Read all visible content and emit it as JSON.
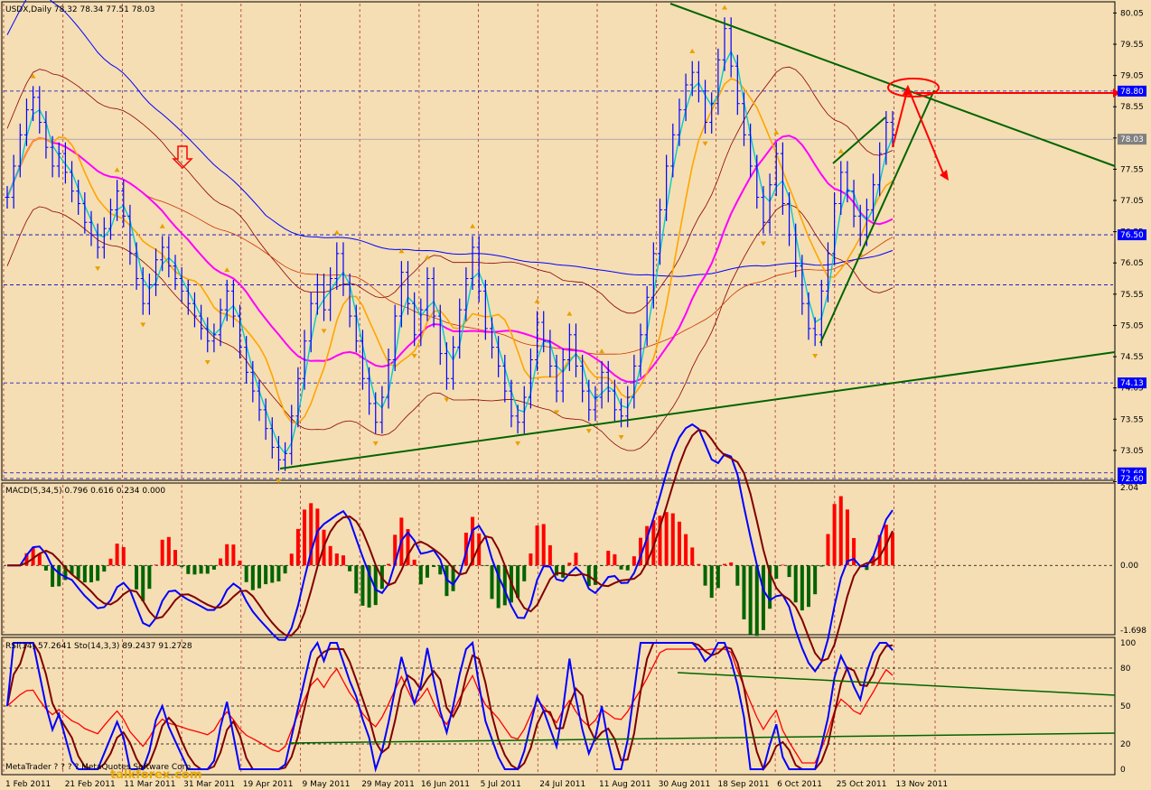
{
  "header": {
    "main": "USDX,Daily  78.32 78.34 77.51 78.03",
    "macd": "MACD(5,34,5) 0.796 0.616 0.234 0.000",
    "rsi": "RSI(14) 57.2641  Sto(14,3,3) 89.2437 91.2728"
  },
  "watermark": {
    "text": "MetaTrader ? ? ? ? MetaQuotes Software Corp.",
    "site": "talkforex.com"
  },
  "colors": {
    "background": "#f5deb3",
    "bull_bar": "#0000ff",
    "bear_bar": "#0000ff",
    "ma_fast": "#00cccc",
    "ma_mid": "#ffa500",
    "ma_slow": "#ff00ff",
    "ma_long": "#0000ff",
    "bands": "#8b0000",
    "trendline": "#006400",
    "marker": "#ff0000",
    "hist_up": "#ff0000",
    "hist_down": "#006400"
  },
  "icons": [
    "down-arrow-signal-icon",
    "fractal-up-icon",
    "fractal-down-icon",
    "target-ellipse-icon",
    "projection-arrow-icon"
  ],
  "chart_data": [
    {
      "type": "candlestick",
      "symbol": "USDX",
      "timeframe": "Daily",
      "ohlc_last": {
        "open": 78.32,
        "high": 78.34,
        "low": 77.51,
        "close": 78.03
      },
      "ylim": [
        72.6,
        80.2
      ],
      "y_ticks": [
        "80.05",
        "79.55",
        "79.05",
        "78.55",
        "78.05",
        "77.55",
        "77.05",
        "76.55",
        "76.05",
        "75.55",
        "75.05",
        "74.55",
        "74.05",
        "73.55",
        "73.05",
        "72.55"
      ],
      "price_tags": [
        {
          "value": 78.8,
          "label": "78.80",
          "color": "#0000ff"
        },
        {
          "value": 78.03,
          "label": "78.03",
          "color": "#808080"
        },
        {
          "value": 76.5,
          "label": "76.50",
          "color": "#0000ff"
        },
        {
          "value": 74.13,
          "label": "74.13",
          "color": "#0000ff"
        },
        {
          "value": 72.69,
          "label": "72.69",
          "color": "#0000ff"
        },
        {
          "value": 72.6,
          "label": "72.60",
          "color": "#0000ff"
        }
      ],
      "hlines": [
        78.8,
        76.5,
        75.7,
        74.13,
        72.69,
        72.6
      ],
      "x_labels": [
        "1 Feb 2011",
        "21 Feb 2011",
        "11 Mar 2011",
        "31 Mar 2011",
        "19 Apr 2011",
        "9 May 2011",
        "29 May 2011",
        "16 Jun 2011",
        "5 Jul 2011",
        "24 Jul 2011",
        "11 Aug 2011",
        "30 Aug 2011",
        "18 Sep 2011",
        "6 Oct 2011",
        "25 Oct 2011",
        "13 Nov 2011"
      ],
      "closes": [
        77.1,
        77.6,
        78.1,
        78.5,
        78.7,
        78.3,
        77.9,
        77.6,
        77.8,
        77.5,
        77.2,
        77.0,
        76.7,
        76.5,
        76.3,
        76.6,
        76.9,
        77.2,
        76.8,
        76.2,
        75.8,
        75.4,
        75.7,
        76.1,
        76.3,
        76.0,
        75.8,
        75.6,
        75.4,
        75.2,
        75.0,
        74.8,
        74.9,
        75.3,
        75.6,
        75.2,
        74.7,
        74.3,
        74.0,
        73.7,
        73.4,
        73.1,
        72.9,
        73.0,
        73.6,
        74.2,
        74.8,
        75.4,
        75.7,
        75.3,
        75.8,
        76.2,
        75.7,
        75.2,
        74.8,
        74.2,
        73.8,
        73.5,
        73.9,
        74.5,
        75.2,
        75.9,
        75.4,
        74.9,
        75.3,
        75.8,
        75.2,
        74.6,
        74.2,
        74.7,
        75.3,
        75.8,
        76.3,
        75.6,
        75.0,
        74.7,
        74.4,
        74.0,
        73.6,
        73.5,
        73.9,
        74.5,
        75.1,
        74.8,
        74.4,
        74.0,
        74.5,
        74.9,
        74.4,
        74.0,
        73.7,
        73.9,
        74.3,
        74.0,
        73.7,
        73.6,
        73.9,
        74.4,
        74.9,
        75.5,
        76.2,
        76.9,
        77.6,
        78.1,
        78.5,
        78.9,
        79.1,
        78.8,
        78.3,
        78.6,
        79.3,
        79.8,
        79.2,
        78.6,
        78.1,
        77.6,
        77.1,
        76.7,
        77.3,
        77.8,
        77.0,
        76.5,
        76.0,
        75.4,
        75.0,
        74.9,
        75.6,
        76.2,
        77.0,
        77.5,
        77.2,
        76.8,
        76.5,
        76.9,
        77.3,
        77.8,
        78.3,
        78.1
      ]
    },
    {
      "type": "line",
      "title": "MACD(5,34,5)",
      "values_label": "0.796 0.616 0.234 0.000",
      "ylim": [
        -1.698,
        2.04
      ],
      "y_ticks": [
        "2.04",
        "0.00",
        "-1.698"
      ]
    },
    {
      "type": "line",
      "title": "RSI(14) Sto(14,3,3)",
      "values_label": "57.2641 89.2437 91.2728",
      "ylim": [
        0,
        100
      ],
      "y_ticks": [
        "100",
        "80",
        "50",
        "20",
        "0"
      ]
    }
  ]
}
